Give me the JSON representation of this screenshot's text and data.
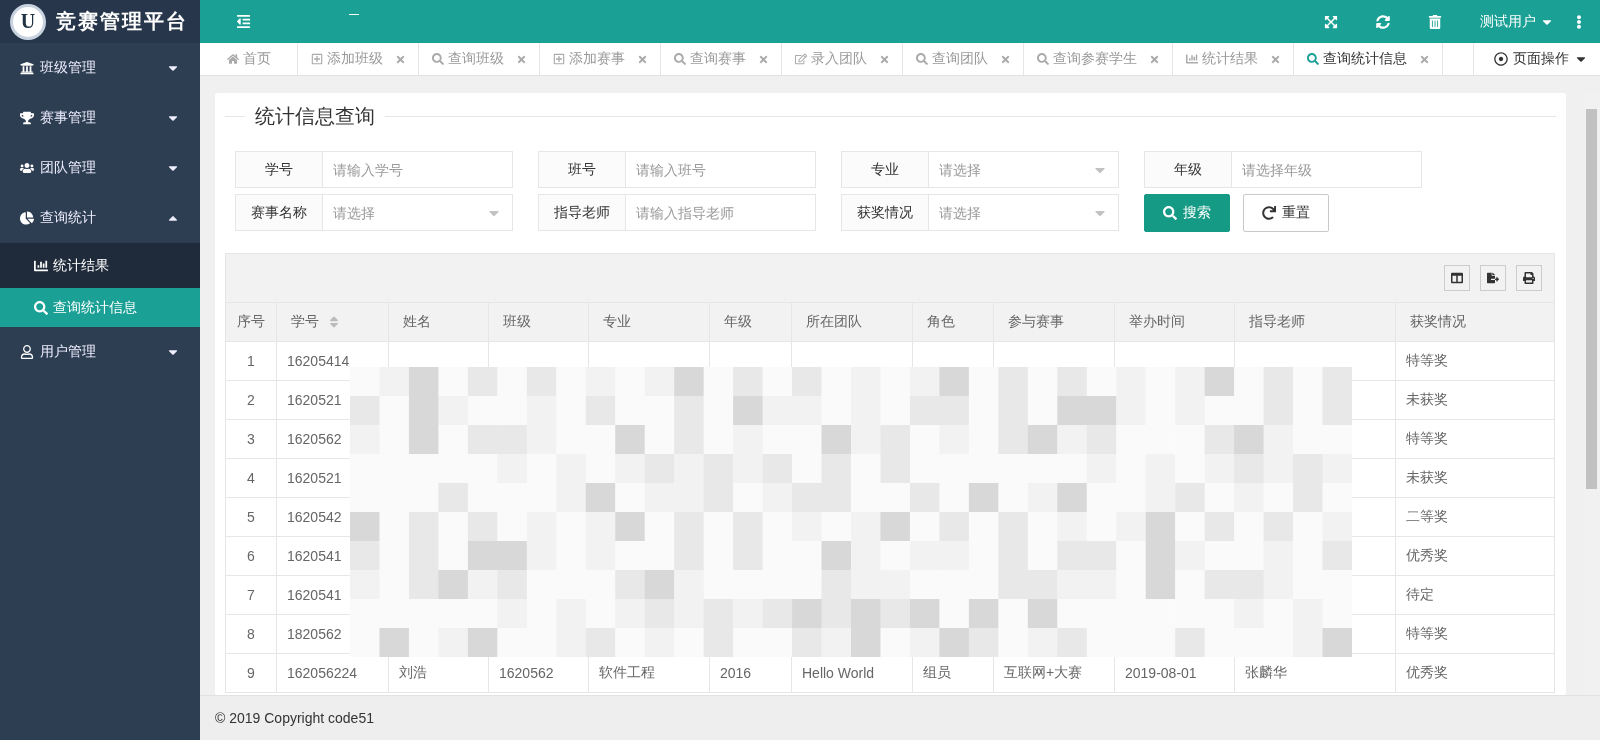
{
  "logo": {
    "mark": "U",
    "title": "竞赛管理平台"
  },
  "header": {
    "user": "测试用户"
  },
  "sidebar": {
    "items": [
      {
        "label": "班级管理",
        "expanded": false
      },
      {
        "label": "赛事管理",
        "expanded": false
      },
      {
        "label": "团队管理",
        "expanded": false
      },
      {
        "label": "查询统计",
        "expanded": true,
        "children": [
          {
            "label": "统计结果",
            "selected": false
          },
          {
            "label": "查询统计信息",
            "selected": true
          }
        ]
      },
      {
        "label": "用户管理",
        "expanded": false
      }
    ]
  },
  "tabs": [
    {
      "label": "首页",
      "selected": false,
      "closable": false
    },
    {
      "label": "添加班级",
      "selected": false,
      "closable": true
    },
    {
      "label": "查询班级",
      "selected": false,
      "closable": true
    },
    {
      "label": "添加赛事",
      "selected": false,
      "closable": true
    },
    {
      "label": "查询赛事",
      "selected": false,
      "closable": true
    },
    {
      "label": "录入团队",
      "selected": false,
      "closable": true
    },
    {
      "label": "查询团队",
      "selected": false,
      "closable": true
    },
    {
      "label": "查询参赛学生",
      "selected": false,
      "closable": true
    },
    {
      "label": "统计结果",
      "selected": false,
      "closable": true
    },
    {
      "label": "查询统计信息",
      "selected": true,
      "closable": true
    }
  ],
  "page_menu": "页面操作",
  "form": {
    "title": "统计信息查询",
    "fields": [
      {
        "label": "学号",
        "kind": "input",
        "placeholder": "请输入学号"
      },
      {
        "label": "班号",
        "kind": "input",
        "placeholder": "请输入班号"
      },
      {
        "label": "专业",
        "kind": "select",
        "placeholder": "请选择"
      },
      {
        "label": "年级",
        "kind": "input",
        "placeholder": "请选择年级"
      },
      {
        "label": "赛事名称",
        "kind": "select",
        "placeholder": "请选择"
      },
      {
        "label": "指导老师",
        "kind": "input",
        "placeholder": "请输入指导老师"
      },
      {
        "label": "获奖情况",
        "kind": "select",
        "placeholder": "请选择"
      }
    ],
    "buttons": [
      {
        "label": "搜索",
        "kind": "primary"
      },
      {
        "label": "重置",
        "kind": "plain"
      }
    ]
  },
  "table": {
    "columns": [
      {
        "label": "序号",
        "sortable": false
      },
      {
        "label": "学号",
        "sortable": true
      },
      {
        "label": "姓名",
        "sortable": false
      },
      {
        "label": "班级",
        "sortable": false
      },
      {
        "label": "专业",
        "sortable": false
      },
      {
        "label": "年级",
        "sortable": false
      },
      {
        "label": "所在团队",
        "sortable": false
      },
      {
        "label": "角色",
        "sortable": false
      },
      {
        "label": "参与赛事",
        "sortable": false
      },
      {
        "label": "举办时间",
        "sortable": false
      },
      {
        "label": "指导老师",
        "sortable": false
      },
      {
        "label": "获奖情况",
        "sortable": false
      }
    ],
    "rows": [
      {
        "no": "1",
        "id": "16205414",
        "award": "特等奖"
      },
      {
        "no": "2",
        "id": "1620521",
        "award": "未获奖"
      },
      {
        "no": "3",
        "id": "1620562",
        "award": "特等奖"
      },
      {
        "no": "4",
        "id": "1620521",
        "award": "未获奖"
      },
      {
        "no": "5",
        "id": "1620542",
        "award": "二等奖"
      },
      {
        "no": "6",
        "id": "1620541",
        "award": "优秀奖"
      },
      {
        "no": "7",
        "id": "1620541",
        "award": "待定"
      },
      {
        "no": "8",
        "id": "1820562",
        "award": "特等奖"
      },
      {
        "no": "9",
        "id": "162056224",
        "name": "刘浩",
        "class": "1620562",
        "major": "软件工程",
        "grade": "2016",
        "team": "Hello World",
        "role": "组员",
        "contest": "互联网+大赛",
        "date": "2019-08-01",
        "teacher": "张麟华",
        "award": "优秀奖"
      }
    ]
  },
  "footer": "© 2019 Copyright code51"
}
